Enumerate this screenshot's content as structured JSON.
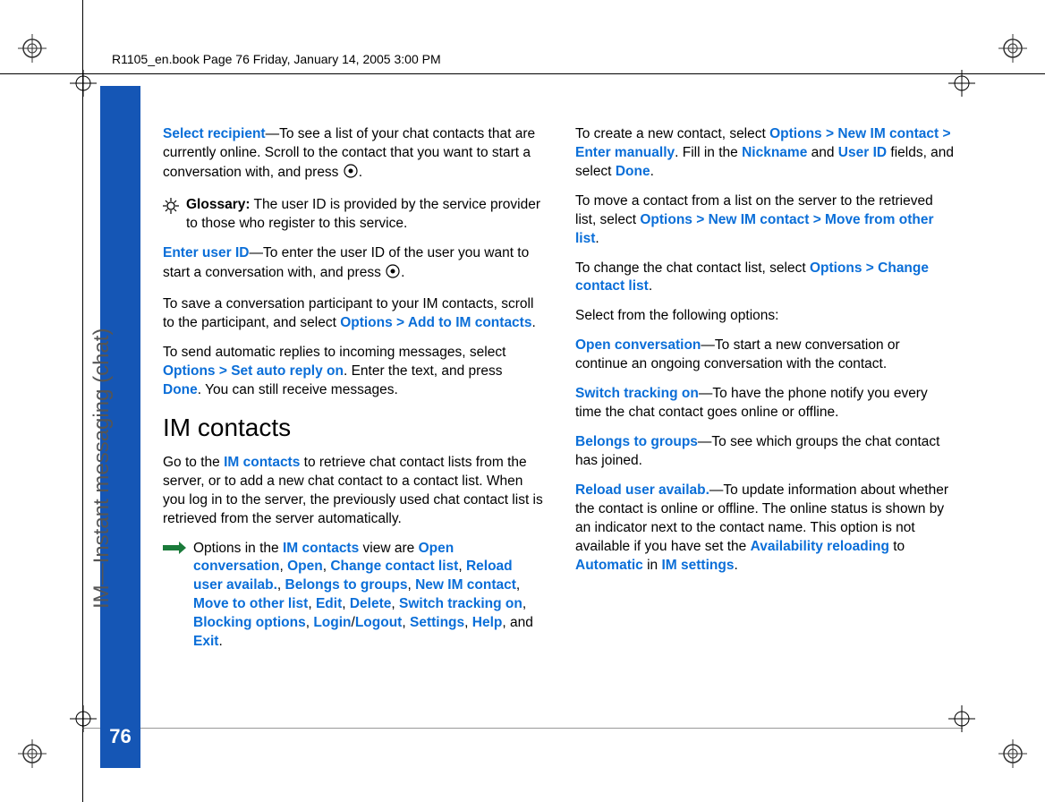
{
  "header": "R1105_en.book  Page 76  Friday, January 14, 2005  3:00 PM",
  "side_label": "IM—Instant messaging (chat)",
  "page_number": "76",
  "col1": {
    "p1a": "Select recipient",
    "p1b": "—To see a list of your chat contacts that are currently online. Scroll to the contact that you want to start a conversation with, and press ",
    "p1c": ".",
    "glossary_label": "Glossary:",
    "glossary_body": " The user ID is provided by the service provider to those who register to this service.",
    "p2a": "Enter user ID",
    "p2b": "—To enter the user ID of the user you want to start a conversation with, and press ",
    "p2c": ".",
    "p3a": "To save a conversation participant to your IM contacts, scroll to the participant, and select ",
    "p3b": "Options > Add to IM contacts",
    "p3c": ".",
    "p4a": "To send automatic replies to incoming messages, select ",
    "p4b": "Options > Set auto reply on",
    "p4c": ". Enter the text, and press ",
    "p4d": "Done",
    "p4e": ". You can still receive messages.",
    "h2": "IM contacts",
    "p5a": "Go to the ",
    "p5b": "IM contacts",
    "p5c": " to retrieve chat contact lists from the server, or to add a new chat contact to a contact list. When you log in to the server, the previously used chat contact list is retrieved from the server automatically.",
    "opt_intro": "Options in the ",
    "opt_view": "IM contacts",
    "opt_mid": " view are ",
    "o1": "Open conversation",
    "c": ", ",
    "o2": "Open",
    "o3": "Change contact list",
    "o4": "Reload user availab.",
    "o5": "Belongs to groups",
    "o6": "New IM contact",
    "o7": "Move to other list",
    "o8": "Edit",
    "o9": "Delete",
    "o10": "Switch tracking on",
    "o11": "Blocking options",
    "o12": "Login",
    "slash": "/",
    "o13": "Logout",
    "o14": "Settings",
    "o15": "Help",
    "and": ", and ",
    "o16": "Exit",
    "dot": "."
  },
  "col2": {
    "p1a": "To create a new contact, select ",
    "p1b": "Options > New IM contact > Enter manually",
    "p1c": ". Fill in the ",
    "p1d": "Nickname",
    "p1e": " and ",
    "p1f": "User ID",
    "p1g": " fields, and select ",
    "p1h": "Done",
    "p1i": ".",
    "p2a": "To move a contact from a list on the server to the retrieved list, select ",
    "p2b": "Options > New IM contact > Move from other list",
    "p2c": ".",
    "p3a": "To change the chat contact list, select ",
    "p3b": "Options > Change contact list",
    "p3c": ".",
    "p4": "Select from the following options:",
    "p5a": "Open conversation",
    "p5b": "—To start a new conversation or continue an ongoing conversation with the contact.",
    "p6a": "Switch tracking on",
    "p6b": "—To have the phone notify you every time the chat contact goes online or offline.",
    "p7a": "Belongs to groups",
    "p7b": "—To see which groups the chat contact has joined.",
    "p8a": "Reload user availab.",
    "p8b": "—To update information about whether the contact is online or offline. The online status is shown by an indicator next to the contact name. This option is not available if you have set the ",
    "p8c": "Availability reloading",
    "p8d": " to ",
    "p8e": "Automatic",
    "p8f": " in ",
    "p8g": "IM settings",
    "p8h": "."
  }
}
